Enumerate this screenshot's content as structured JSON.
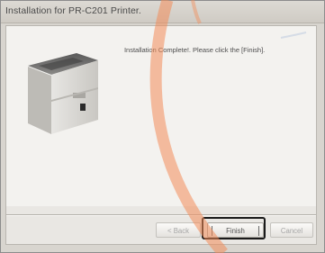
{
  "window": {
    "title": "Installation for PR-C201 Printer."
  },
  "content": {
    "message": "Installation Complete!. Please click the [Finish].",
    "image_icon": "printer-image"
  },
  "buttons": {
    "back_label": "< Back",
    "finish_label": "Finish",
    "cancel_label": "Cancel"
  },
  "colors": {
    "accent_arc": "#f28d5a",
    "highlight_frame": "#1a1a1a"
  }
}
